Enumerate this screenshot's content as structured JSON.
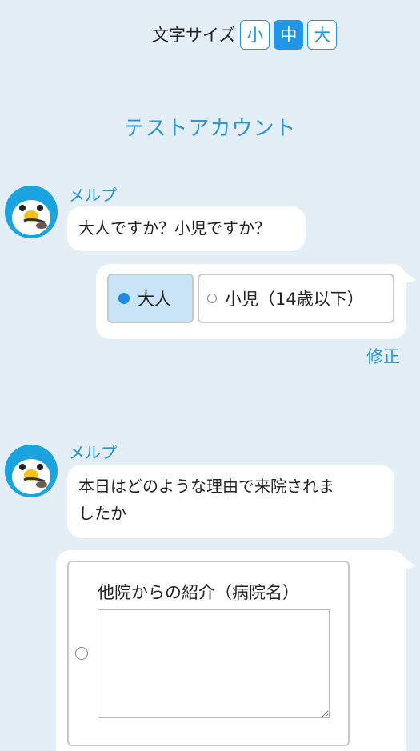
{
  "font_size_control": {
    "label": "文字サイズ",
    "options": [
      "小",
      "中",
      "大"
    ],
    "selected": "中"
  },
  "account": {
    "name": "テストアカウント"
  },
  "conversation": {
    "bot_name": "メルプ",
    "q1": {
      "question": "大人ですか？小児ですか？",
      "options": [
        "大人",
        "小児（14歳以下）"
      ],
      "selected": "大人",
      "edit_label": "修正"
    },
    "q2": {
      "question_line1": "本日はどのような理由で来院されま",
      "question_line2": "したか",
      "option_label": "他院からの紹介（病院名）",
      "option_value": ""
    }
  },
  "colors": {
    "background": "#e4eef7",
    "accent": "#2a96d3",
    "selected_option_bg": "#c9e4f6"
  }
}
